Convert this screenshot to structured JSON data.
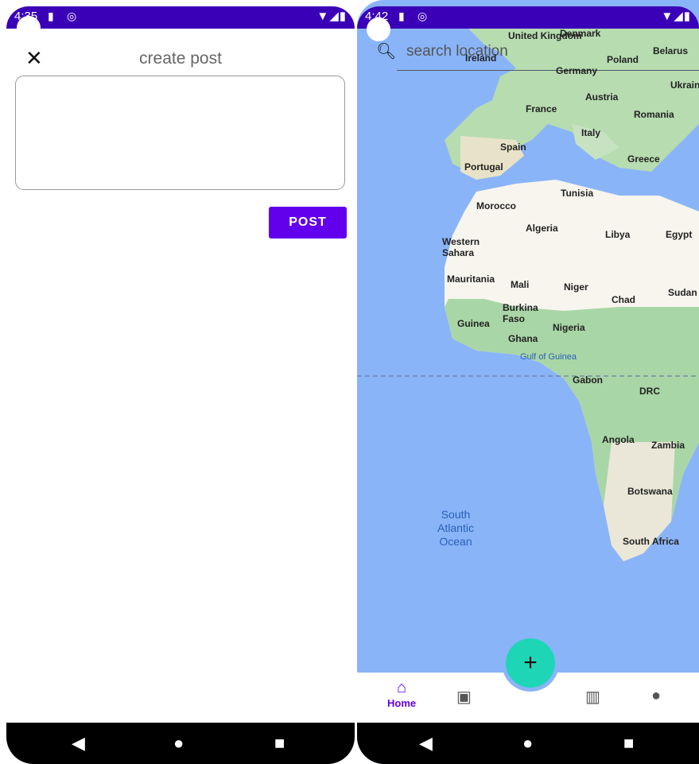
{
  "left_screen": {
    "status_time": "4:35",
    "title": "create post",
    "post_label": "POST",
    "text_placeholder": ""
  },
  "right_screen": {
    "status_time": "4:42",
    "search_placeholder": "search location",
    "map_labels": {
      "united_kingdom": "United Kingdom",
      "ireland": "Ireland",
      "denmark": "Denmark",
      "belarus": "Belarus",
      "poland": "Poland",
      "germany": "Germany",
      "ukraine": "Ukrain",
      "austria": "Austria",
      "france": "France",
      "romania": "Romania",
      "italy": "Italy",
      "spain": "Spain",
      "portugal": "Portugal",
      "greece": "Greece",
      "tunisia": "Tunisia",
      "morocco": "Morocco",
      "algeria": "Algeria",
      "libya": "Libya",
      "egypt": "Egypt",
      "western_sahara": "Western Sahara",
      "mauritania": "Mauritania",
      "mali": "Mali",
      "niger": "Niger",
      "chad": "Chad",
      "sudan": "Sudan",
      "burkina_faso": "Burkina Faso",
      "guinea": "Guinea",
      "nigeria": "Nigeria",
      "ghana": "Ghana",
      "gulf_of_guinea": "Gulf of Guinea",
      "gabon": "Gabon",
      "drc": "DRC",
      "angola": "Angola",
      "zambia": "Zambia",
      "botswana": "Botswana",
      "south_africa": "South Africa",
      "south_atlantic_ocean": "South Atlantic Ocean"
    },
    "fab_label": "+",
    "nav": {
      "home_label": "Home"
    }
  }
}
